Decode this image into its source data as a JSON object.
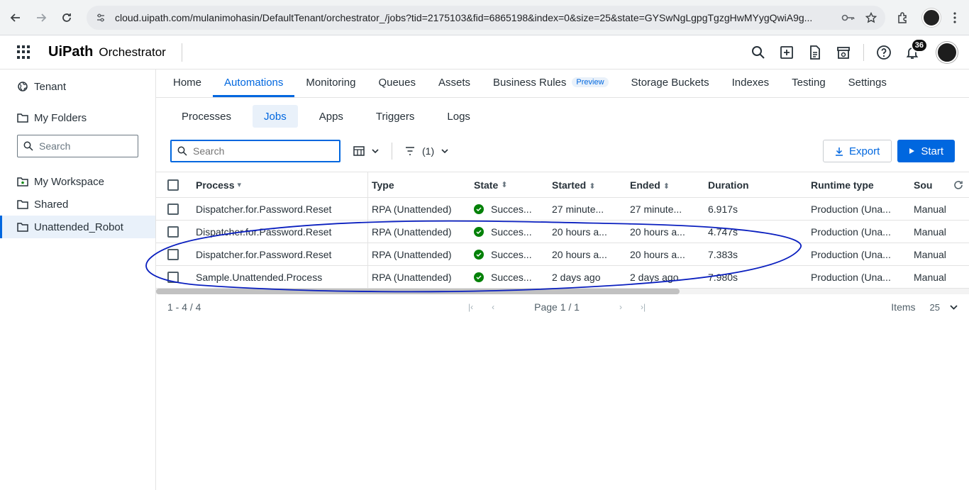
{
  "browser": {
    "url": "cloud.uipath.com/mulanimohasin/DefaultTenant/orchestrator_/jobs?tid=2175103&fid=6865198&index=0&size=25&state=GYSwNgLgpgTgzgHwMYygQwiA9g..."
  },
  "header": {
    "brand": "UiPath",
    "product": "Orchestrator",
    "notifications_count": "36"
  },
  "sidebar": {
    "tenant": "Tenant",
    "folders_title": "My Folders",
    "search_placeholder": "Search",
    "items": [
      {
        "label": "My Workspace",
        "icon": "workspace-folder-icon"
      },
      {
        "label": "Shared",
        "icon": "folder-icon"
      },
      {
        "label": "Unattended_Robot",
        "icon": "folder-icon",
        "active": true
      }
    ]
  },
  "top_tabs": [
    "Home",
    "Automations",
    "Monitoring",
    "Queues",
    "Assets",
    "Business Rules",
    "Storage Buckets",
    "Indexes",
    "Testing",
    "Settings"
  ],
  "top_tabs_preview": "Preview",
  "active_top_tab": "Automations",
  "sub_tabs": [
    "Processes",
    "Jobs",
    "Apps",
    "Triggers",
    "Logs"
  ],
  "active_sub_tab": "Jobs",
  "toolbar": {
    "search_placeholder": "Search",
    "filter_count": "(1)",
    "export_label": "Export",
    "start_label": "Start"
  },
  "table": {
    "headers": {
      "process": "Process",
      "type": "Type",
      "state": "State",
      "started": "Started",
      "ended": "Ended",
      "duration": "Duration",
      "runtime": "Runtime type",
      "source": "Sou"
    },
    "rows": [
      {
        "process": "Dispatcher.for.Password.Reset",
        "type": "RPA (Unattended)",
        "state": "Succes...",
        "started": "27 minute...",
        "ended": "27 minute...",
        "duration": "6.917s",
        "runtime": "Production (Una...",
        "source": "Manual"
      },
      {
        "process": "Dispatcher.for.Password.Reset",
        "type": "RPA (Unattended)",
        "state": "Succes...",
        "started": "20 hours a...",
        "ended": "20 hours a...",
        "duration": "4.747s",
        "runtime": "Production (Una...",
        "source": "Manual"
      },
      {
        "process": "Dispatcher.for.Password.Reset",
        "type": "RPA (Unattended)",
        "state": "Succes...",
        "started": "20 hours a...",
        "ended": "20 hours a...",
        "duration": "7.383s",
        "runtime": "Production (Una...",
        "source": "Manual"
      },
      {
        "process": "Sample.Unattended.Process",
        "type": "RPA (Unattended)",
        "state": "Succes...",
        "started": "2 days ago",
        "ended": "2 days ago",
        "duration": "7.980s",
        "runtime": "Production (Una...",
        "source": "Manual"
      }
    ]
  },
  "pager": {
    "range": "1 - 4 / 4",
    "page": "Page 1 / 1",
    "items_label": "Items",
    "items_value": "25"
  },
  "colors": {
    "accent": "#0067df",
    "success": "#038108",
    "annotation": "#0a1fbf"
  }
}
